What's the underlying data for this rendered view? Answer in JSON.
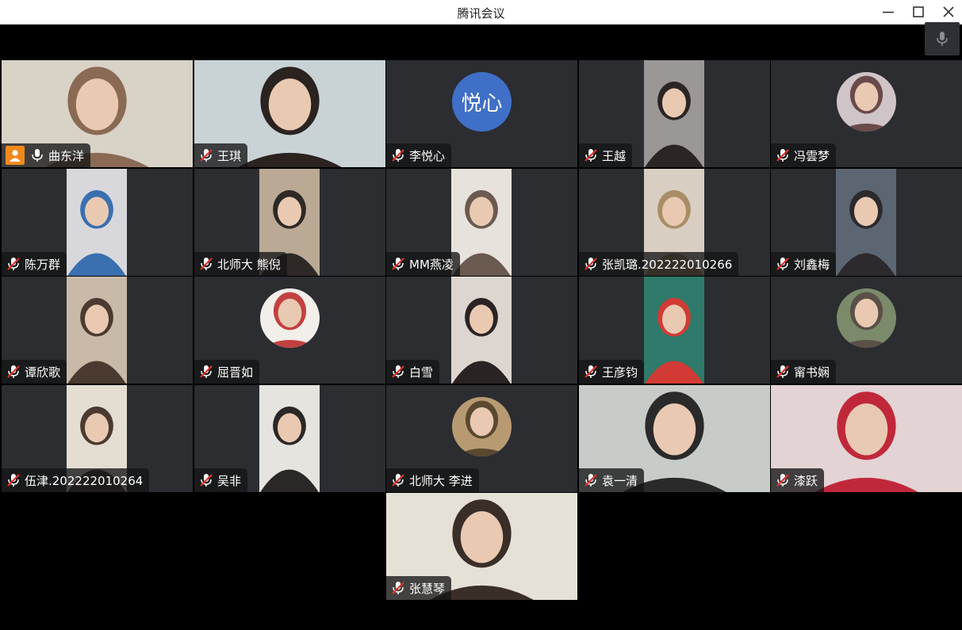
{
  "window": {
    "title": "腾讯会议"
  },
  "participants": [
    {
      "name": "曲东洋",
      "mic": "on",
      "host": true,
      "active": true,
      "media": "wide",
      "tone": [
        "#d9d2c6",
        "#8a6a55"
      ]
    },
    {
      "name": "王琪",
      "mic": "muted",
      "media": "wide",
      "tone": [
        "#c9d3d6",
        "#2a2320"
      ]
    },
    {
      "name": "李悦心",
      "mic": "muted",
      "media": "avatar-text",
      "avatar_text": "悦心"
    },
    {
      "name": "王越",
      "mic": "muted",
      "media": "portrait",
      "tone": [
        "#9a9796",
        "#2b2524"
      ]
    },
    {
      "name": "冯雲梦",
      "mic": "muted",
      "media": "avatar-photo",
      "tone": [
        "#cfc4c7",
        "#6a4a4a"
      ]
    },
    {
      "name": "陈万群",
      "mic": "muted",
      "media": "portrait",
      "tone": [
        "#d8d8dc",
        "#3a6fb0"
      ]
    },
    {
      "name": "北师大 熊倪",
      "mic": "muted",
      "media": "portrait",
      "tone": [
        "#b9a995",
        "#2e2826"
      ]
    },
    {
      "name": "MM燕凌",
      "mic": "muted",
      "media": "portrait",
      "tone": [
        "#e8e2dc",
        "#6b5a50"
      ]
    },
    {
      "name": "张凯璐.202222010266",
      "mic": "muted",
      "media": "portrait",
      "tone": [
        "#d8cfc2",
        "#a88d67"
      ]
    },
    {
      "name": "刘鑫梅",
      "mic": "muted",
      "media": "portrait",
      "tone": [
        "#5c6672",
        "#2c2a2d"
      ]
    },
    {
      "name": "谭欣歌",
      "mic": "muted",
      "media": "portrait",
      "tone": [
        "#c8b9a8",
        "#4b3a2f"
      ]
    },
    {
      "name": "屈晋如",
      "mic": "muted",
      "media": "avatar-photo",
      "tone": [
        "#f2eeea",
        "#c24040"
      ]
    },
    {
      "name": "白雪",
      "mic": "muted",
      "media": "portrait",
      "tone": [
        "#ddd6d0",
        "#2a2323"
      ]
    },
    {
      "name": "王彦钧",
      "mic": "muted",
      "media": "portrait",
      "tone": [
        "#2f7a6a",
        "#d23b35"
      ]
    },
    {
      "name": "甯书娴",
      "mic": "muted",
      "media": "avatar-photo",
      "tone": [
        "#7a8a6a",
        "#5a5048"
      ]
    },
    {
      "name": "伍津.202222010264",
      "mic": "muted",
      "media": "portrait",
      "tone": [
        "#e4ddd2",
        "#4a3a30"
      ]
    },
    {
      "name": "吴非",
      "mic": "muted",
      "media": "portrait",
      "tone": [
        "#e6e4df",
        "#2b2726"
      ]
    },
    {
      "name": "北师大 李进",
      "mic": "muted",
      "media": "avatar-photo",
      "tone": [
        "#b89a72",
        "#5a4830"
      ]
    },
    {
      "name": "袁一清",
      "mic": "muted",
      "media": "wide",
      "tone": [
        "#c8ccc8",
        "#2a2a2a"
      ]
    },
    {
      "name": "漆跃",
      "mic": "muted",
      "media": "wide",
      "tone": [
        "#e3d3d4",
        "#c0283a"
      ]
    },
    {
      "name": "张慧琴",
      "mic": "muted",
      "media": "wide",
      "tone": [
        "#e6e1d6",
        "#3a2e28"
      ]
    }
  ]
}
